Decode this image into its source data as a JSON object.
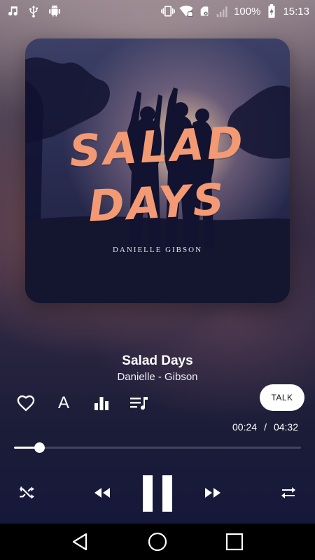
{
  "status_bar": {
    "left_icons": [
      "music-note-icon",
      "usb-icon",
      "android-icon"
    ],
    "right_icons": [
      "vibrate-icon",
      "wifi-icon",
      "sim-icon",
      "signal-icon"
    ],
    "battery_percent": "100%",
    "battery_level": 1.0,
    "time": "15:13"
  },
  "album_art": {
    "title_line1": "SALAD",
    "title_line2": "DAYS",
    "artist": "DANIELLE GIBSON",
    "title_color": "#f39a74"
  },
  "track": {
    "title": "Salad Days",
    "artist": "Danielle - Gibson"
  },
  "actions": {
    "favorite_icon": "heart-outline-icon",
    "font_label": "A",
    "equalizer_icon": "equalizer-icon",
    "playlist_icon": "playlist-icon"
  },
  "talk_button": {
    "label": "TALK"
  },
  "playback": {
    "current_time": "00:24",
    "separator": "/",
    "total_time": "04:32",
    "progress_fraction": 0.088
  },
  "controls": {
    "shuffle_icon": "shuffle-icon",
    "rewind_icon": "rewind-icon",
    "play_pause_icon": "pause-icon",
    "fast_forward_icon": "fast-forward-icon",
    "repeat_icon": "repeat-icon"
  },
  "nav_bar": {
    "back_icon": "back-triangle-icon",
    "home_icon": "home-circle-icon",
    "recents_icon": "recents-square-icon"
  }
}
